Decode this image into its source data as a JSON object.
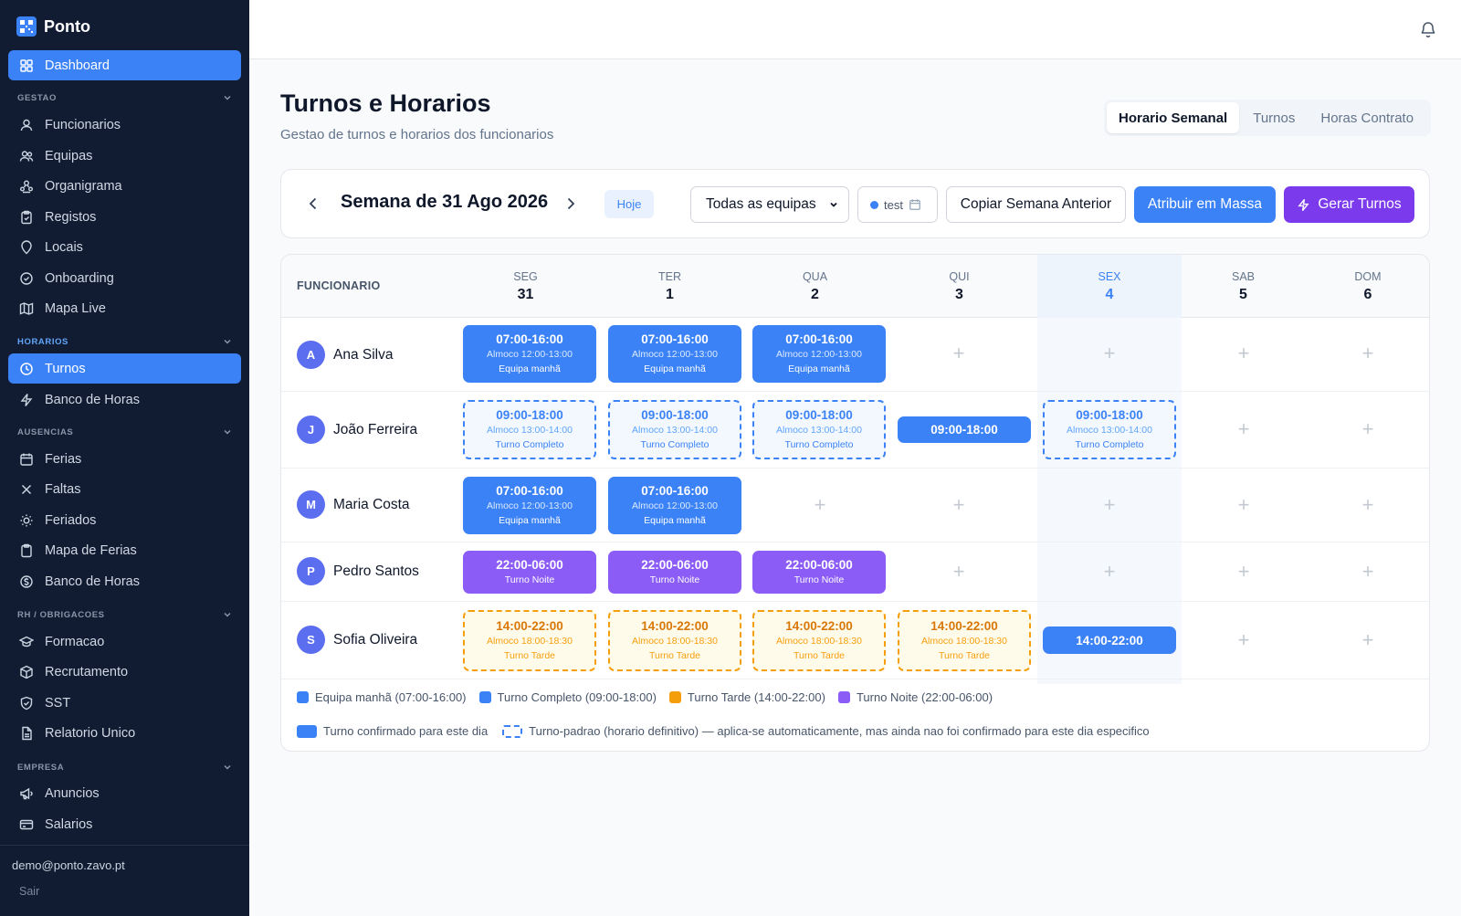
{
  "app": {
    "name": "Ponto"
  },
  "sidebar": {
    "dashboard": "Dashboard",
    "sections": {
      "gestao": "GESTAO",
      "horarios": "HORARIOS",
      "ausencias": "AUSENCIAS",
      "rh": "RH / OBRIGACOES",
      "empresa": "EMPRESA"
    },
    "items": {
      "funcionarios": "Funcionarios",
      "equipas": "Equipas",
      "organigrama": "Organigrama",
      "registos": "Registos",
      "locais": "Locais",
      "onboarding": "Onboarding",
      "mapa_live": "Mapa Live",
      "turnos": "Turnos",
      "banco_horas_1": "Banco de Horas",
      "ferias": "Ferias",
      "faltas": "Faltas",
      "feriados": "Feriados",
      "mapa_ferias": "Mapa de Ferias",
      "banco_horas_2": "Banco de Horas",
      "formacao": "Formacao",
      "recrutamento": "Recrutamento",
      "sst": "SST",
      "relatorio_unico": "Relatorio Unico",
      "anuncios": "Anuncios",
      "salarios": "Salarios"
    },
    "user_email": "demo@ponto.zavo.pt",
    "logout": "Sair"
  },
  "header": {
    "title": "Turnos e Horarios",
    "subtitle": "Gestao de turnos e horarios dos funcionarios",
    "tabs": [
      "Horario Semanal",
      "Turnos",
      "Horas Contrato"
    ]
  },
  "toolbar": {
    "week_title": "Semana de 31 Ago 2026",
    "today": "Hoje",
    "team_select": "Todas as equipas",
    "date_value": "test",
    "copy_week": "Copiar Semana Anterior",
    "bulk_assign": "Atribuir em Massa",
    "generate": "Gerar Turnos"
  },
  "table": {
    "employee_header": "FUNCIONARIO",
    "days": [
      {
        "name": "SEG",
        "date": "31"
      },
      {
        "name": "TER",
        "date": "1"
      },
      {
        "name": "QUA",
        "date": "2"
      },
      {
        "name": "QUI",
        "date": "3"
      },
      {
        "name": "SEX",
        "date": "4"
      },
      {
        "name": "SAB",
        "date": "5"
      },
      {
        "name": "DOM",
        "date": "6"
      }
    ],
    "employees": [
      {
        "initial": "A",
        "name": "Ana Silva"
      },
      {
        "initial": "J",
        "name": "João Ferreira"
      },
      {
        "initial": "M",
        "name": "Maria Costa"
      },
      {
        "initial": "P",
        "name": "Pedro Santos"
      },
      {
        "initial": "S",
        "name": "Sofia Oliveira"
      }
    ],
    "shift_texts": {
      "morning_time": "07:00-16:00",
      "morning_lunch": "Almoco 12:00-13:00",
      "morning_name": "Equipa manhã",
      "full_time": "09:00-18:00",
      "full_lunch": "Almoco 13:00-14:00",
      "full_name": "Turno Completo",
      "night_time": "22:00-06:00",
      "night_name": "Turno Noite",
      "late_time": "14:00-22:00",
      "late_lunch": "Almoco 18:00-18:30",
      "late_name": "Turno Tarde"
    },
    "add_symbol": "+"
  },
  "legend": {
    "items": [
      "Equipa manhã (07:00-16:00)",
      "Turno Completo (09:00-18:00)",
      "Turno Tarde (14:00-22:00)",
      "Turno Noite (22:00-06:00)"
    ],
    "confirmed": "Turno confirmado para este dia",
    "default_pattern": "Turno-padrao (horario definitivo) — aplica-se automaticamente, mas ainda nao foi confirmado para este dia especifico"
  },
  "colors": {
    "sidebar_bg": "#111c33",
    "accent_blue": "#3b82f6",
    "accent_purple": "#7c3aed",
    "night_purple": "#8b5cf6",
    "late_orange": "#f59e0b"
  }
}
